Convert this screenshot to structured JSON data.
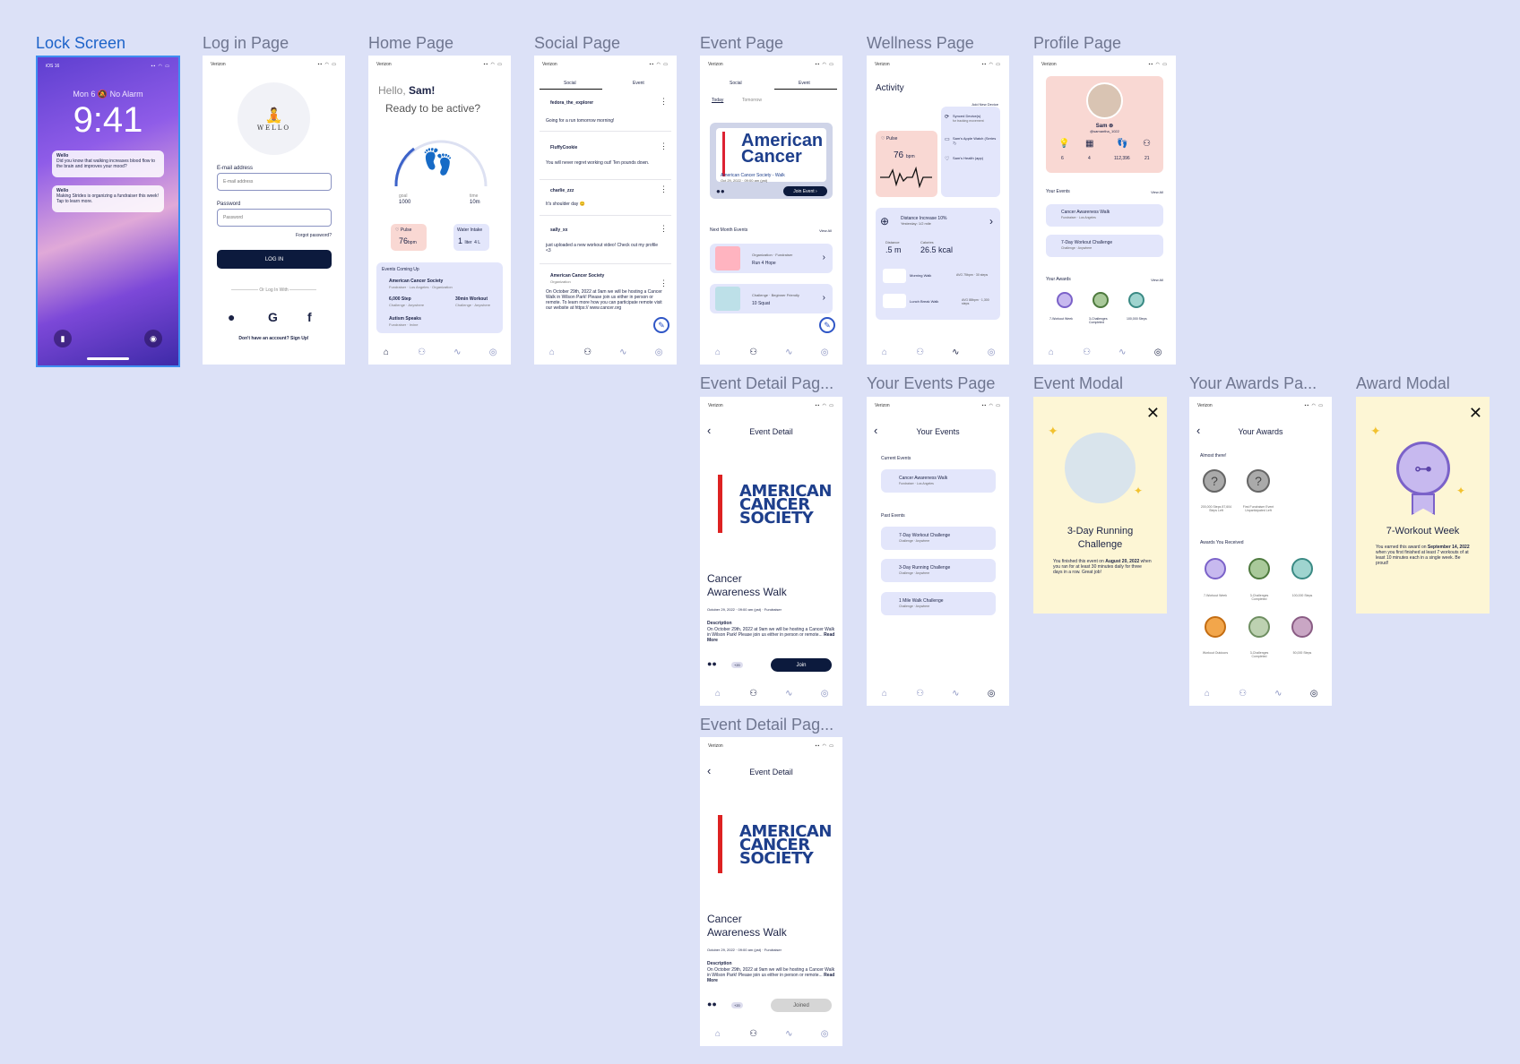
{
  "frame_titles": {
    "lock": "Lock Screen",
    "login": "Log in Page",
    "home": "Home Page",
    "social": "Social Page",
    "event": "Event Page",
    "wellness": "Wellness Page",
    "profile": "Profile Page",
    "event_detail_1": "Event Detail Pag...",
    "your_events": "Your Events Page",
    "event_modal": "Event Modal",
    "your_awards": "Your Awards Pa...",
    "award_modal": "Award Modal",
    "event_detail_2": "Event Detail Pag..."
  },
  "status": {
    "carrier": "Verizon",
    "ios": "iOS 16"
  },
  "lock": {
    "date": "Mon 6",
    "alarm": "No Alarm",
    "time": "9:41",
    "notif1_app": "Wello",
    "notif1_text": "Did you know that walking increases blood flow to the brain and improves your mood?",
    "notif2_app": "Wello",
    "notif2_text": "Making Strides is organizing a fundraiser this week! Tap to learn more."
  },
  "login": {
    "logo": "WELLO",
    "email_label": "E-mail address",
    "email_placeholder": "E-mail address",
    "password_label": "Password",
    "password_placeholder": "Password",
    "forgot": "Forgot password?",
    "login_btn": "LOG IN",
    "or_with": "Or Log In With",
    "signup": "Don't have an account? Sign Up!"
  },
  "home": {
    "hello": "Hello,",
    "name": "Sam!",
    "ready": "Ready to be active?",
    "goal_label": "goal",
    "goal_value": "1000",
    "time_label": "time",
    "time_value": "10m",
    "pulse_label": "Pulse",
    "pulse_value": "76",
    "pulse_unit": "bpm",
    "water_label": "Water Intake",
    "water_value": "1",
    "water_unit": "liter",
    "water_goal": "4 L",
    "events_title": "Events Coming Up",
    "ev1": "American Cancer Society",
    "ev1_sub": "Fundraiser · Los Angeles · Organization",
    "ev2": "6,000 Step",
    "ev2_sub": "Challenge · Anywhere",
    "ev3": "30min Workout",
    "ev3_sub": "Challenge · Anywhere",
    "ev4": "Autism Speaks",
    "ev4_sub": "Fundraiser · Irvine"
  },
  "social": {
    "tab1": "Social",
    "tab2": "Event",
    "posts": [
      {
        "user": "fedora_the_explorer",
        "text": "Going for a run tomorrow morning!"
      },
      {
        "user": "FluffyCookie",
        "text": "You will never regret working out! Ten pounds down."
      },
      {
        "user": "charlie_zzz",
        "text": "It's shoulder day 😊"
      },
      {
        "user": "sally_xx",
        "text": "just uploaded a new workout video! Check out my profile <3"
      },
      {
        "user": "American Cancer Society",
        "sub": "Organization",
        "text": "On October 29th, 2022 at 9am we will be hosting a Cancer Walk in Wilson Park! Please join us either in person or remote. To learn more how you can participate remote visit our website at https:// www.cancer.org"
      }
    ]
  },
  "event": {
    "tab1": "Social",
    "tab2": "Event",
    "today": "Today",
    "tomorrow": "Tomorrow",
    "banner_line1": "American",
    "banner_line2": "Cancer",
    "banner_title": "American Cancer Society - Walk",
    "banner_date": "Oct 29, 2022 · 09:00 am (pst)",
    "join_event": "Join Event",
    "next_month": "Next Month Events",
    "view_all": "View All",
    "e1_meta": "Organization · Fundraiser",
    "e1_title": "Run 4 Hope",
    "e2_meta": "Challenge · Beginner Friendly",
    "e2_title": "10 Squat"
  },
  "wellness": {
    "title": "Activity",
    "add_device": "Add New Device",
    "pulse_label": "Pulse",
    "pulse_value": "76",
    "pulse_unit": "bpm",
    "synced": "Synced Device(s)",
    "synced_sub": "for tracking movement",
    "watch": "Sam's Apple Watch (Series 7)",
    "health": "Sam's Health (app)",
    "dist_inc": "Distance Increase 10%",
    "dist_sub": "Yesterday: 1/2 mile",
    "distance_label": "Distance",
    "distance_value": ".5 m",
    "cal_label": "Calories",
    "cal_value": "26.5 kcal",
    "walk1": "Morning Walk",
    "walk1_meta": "AVG 75bpm · 30 steps",
    "walk2": "Lunch Break Walk",
    "walk2_meta": "AVG 88bpm · 1,300 steps"
  },
  "profile": {
    "name": "Sam",
    "handle": "@samantha_1022",
    "stats": [
      "6",
      "4",
      "112,396",
      "21"
    ],
    "your_events": "Your Events",
    "view_all": "View All",
    "ev1": "Cancer Awareness Walk",
    "ev1_sub": "Fundraiser · Los Angeles",
    "ev2": "7-Day Workout Challenge",
    "ev2_sub": "Challenge · Anywhere",
    "your_awards": "Your Awards",
    "awards": [
      "7-Workout Week",
      "3-Challenges Completed",
      "100,000 Steps"
    ]
  },
  "event_detail": {
    "header": "Event Detail",
    "acs1": "AMERICAN",
    "acs2": "CANCER",
    "acs3": "SOCIETY",
    "title_l1": "Cancer",
    "title_l2": "Awareness Walk",
    "meta": "October 29, 2022 · 09:00 am (pst) · Fundraiser",
    "desc_label": "Description",
    "desc": "On October 29th, 2022 at 9am we will be hosting a Cancer Walk in Wilson Park! Please join us either in person or remote...",
    "read_more": "Read More",
    "join": "Join",
    "joined": "Joined",
    "count": "+20"
  },
  "your_events": {
    "header": "Your Events",
    "current": "Current Events",
    "cur1": "Cancer Awareness Walk",
    "cur1_sub": "Fundraiser · Los Angeles",
    "past": "Past Events",
    "p1": "7-Day Workout Challenge",
    "p1_sub": "Challenge · Anywhere",
    "p2": "3-Day Running Challenge",
    "p2_sub": "Challenge · Anywhere",
    "p3": "1 Mile Walk Challenge",
    "p3_sub": "Challenge · Anywhere"
  },
  "event_modal": {
    "title_l1": "3-Day Running",
    "title_l2": "Challenge",
    "text_a": "You finished this event on ",
    "text_b": "August 20, 2022",
    "text_c": " when you ran for at least 30 minutes daily for three days in a row. Great job!"
  },
  "your_awards": {
    "header": "Your Awards",
    "almost": "Almost there!",
    "a1": "200,000 Steps 87,604 Steps Left",
    "a2": "First Fundraiser Event Unparticipated Left",
    "received": "Awards You Received",
    "r1": "7-Workout Week",
    "r2": "3-Challenges Completed",
    "r3": "100,000 Steps",
    "r4": "Workout Outdoors",
    "r5": "3-Challenges Completed",
    "r6": "50,000 Steps"
  },
  "award_modal": {
    "title": "7-Workout Week",
    "text_a": "You earned this award on ",
    "text_b": "September 14, 2022",
    "text_c": " when you first finished at least 7 workouts of at least 10 minutes each in a single week. Be proud!"
  },
  "colors": {
    "bg": "#dce1f7",
    "accent": "#1d63c9",
    "dark": "#0c1a3d",
    "modal": "#fdf6d5"
  }
}
